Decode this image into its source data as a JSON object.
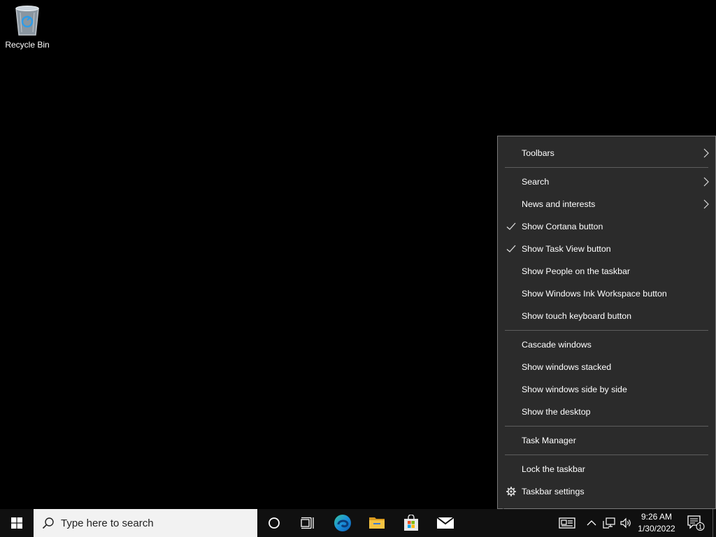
{
  "desktop": {
    "icons": [
      {
        "label": "Recycle Bin",
        "icon": "recycle-bin-icon"
      }
    ]
  },
  "context_menu": {
    "groups": [
      [
        {
          "label": "Toolbars",
          "submenu": true
        }
      ],
      [
        {
          "label": "Search",
          "submenu": true
        },
        {
          "label": "News and interests",
          "submenu": true
        },
        {
          "label": "Show Cortana button",
          "checked": true
        },
        {
          "label": "Show Task View button",
          "checked": true
        },
        {
          "label": "Show People on the taskbar"
        },
        {
          "label": "Show Windows Ink Workspace button"
        },
        {
          "label": "Show touch keyboard button"
        }
      ],
      [
        {
          "label": "Cascade windows"
        },
        {
          "label": "Show windows stacked"
        },
        {
          "label": "Show windows side by side"
        },
        {
          "label": "Show the desktop"
        }
      ],
      [
        {
          "label": "Task Manager"
        }
      ],
      [
        {
          "label": "Lock the taskbar"
        },
        {
          "label": "Taskbar settings",
          "icon": "gear-icon"
        }
      ]
    ]
  },
  "taskbar": {
    "search_placeholder": "Type here to search",
    "pinned": [
      "cortana-icon",
      "task-view-icon",
      "edge-icon",
      "file-explorer-icon",
      "store-icon",
      "mail-icon"
    ],
    "tray_icons": [
      "news-icon",
      "chevron-up-icon",
      "network-icon",
      "volume-icon"
    ],
    "time": "9:26 AM",
    "date": "1/30/2022",
    "notification_count": "1"
  },
  "colors": {
    "desktop": "#000000",
    "menu_bg": "#2b2b2b",
    "taskbar_bg": "#101010",
    "edge_blue": "#0f7dd4",
    "folder_yellow": "#f5c342"
  }
}
